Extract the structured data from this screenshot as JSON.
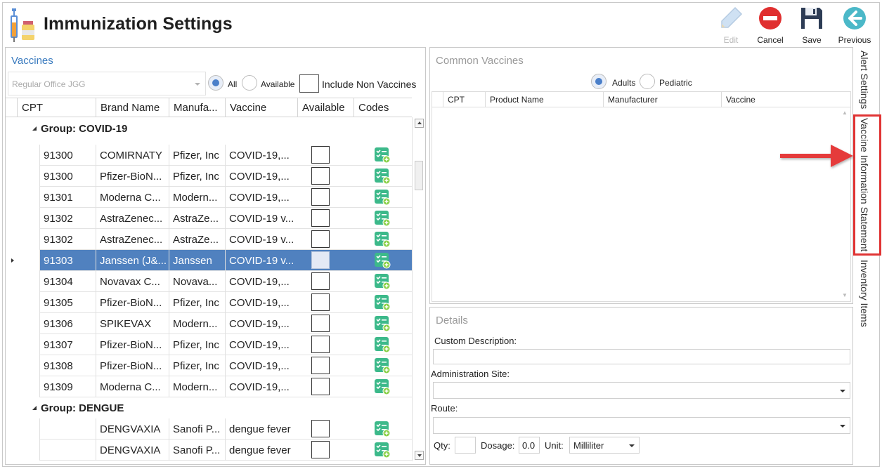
{
  "header": {
    "title": "Immunization Settings",
    "toolbar": [
      {
        "label": "Edit",
        "icon": "edit-pencil-icon",
        "enabled": false
      },
      {
        "label": "Cancel",
        "icon": "cancel-icon"
      },
      {
        "label": "Save",
        "icon": "save-floppy-icon"
      },
      {
        "label": "Previous",
        "icon": "previous-arrow-icon"
      }
    ]
  },
  "vaccines": {
    "label": "Vaccines",
    "office_placeholder": "Regular Office JGG",
    "filters": {
      "all": "All",
      "available": "Available",
      "include_non": "Include Non Vaccines",
      "selected": "All"
    },
    "columns": [
      "CPT",
      "Brand Name",
      "Manufa...",
      "Vaccine",
      "Available",
      "Codes"
    ],
    "groups": [
      {
        "title": "Group: COVID-19",
        "rows": [
          {
            "cpt": "91300",
            "brand": "COMIRNATY",
            "manufacturer": "Pfizer, Inc",
            "vaccine": "COVID-19,...",
            "selected": false
          },
          {
            "cpt": "91300",
            "brand": "Pfizer-BioN...",
            "manufacturer": "Pfizer, Inc",
            "vaccine": "COVID-19,...",
            "selected": false
          },
          {
            "cpt": "91301",
            "brand": "Moderna C...",
            "manufacturer": "Modern...",
            "vaccine": "COVID-19,...",
            "selected": false
          },
          {
            "cpt": "91302",
            "brand": "AstraZenec...",
            "manufacturer": "AstraZe...",
            "vaccine": "COVID-19 v...",
            "selected": false
          },
          {
            "cpt": "91302",
            "brand": "AstraZenec...",
            "manufacturer": "AstraZe...",
            "vaccine": "COVID-19 v...",
            "selected": false
          },
          {
            "cpt": "91303",
            "brand": "Janssen (J&...",
            "manufacturer": "Janssen",
            "vaccine": "COVID-19 v...",
            "selected": true
          },
          {
            "cpt": "91304",
            "brand": "Novavax C...",
            "manufacturer": "Novava...",
            "vaccine": "COVID-19,...",
            "selected": false
          },
          {
            "cpt": "91305",
            "brand": "Pfizer-BioN...",
            "manufacturer": "Pfizer, Inc",
            "vaccine": "COVID-19,...",
            "selected": false
          },
          {
            "cpt": "91306",
            "brand": "SPIKEVAX",
            "manufacturer": "Modern...",
            "vaccine": "COVID-19,...",
            "selected": false
          },
          {
            "cpt": "91307",
            "brand": "Pfizer-BioN...",
            "manufacturer": "Pfizer, Inc",
            "vaccine": "COVID-19,...",
            "selected": false
          },
          {
            "cpt": "91308",
            "brand": "Pfizer-BioN...",
            "manufacturer": "Pfizer, Inc",
            "vaccine": "COVID-19,...",
            "selected": false
          },
          {
            "cpt": "91309",
            "brand": "Moderna C...",
            "manufacturer": "Modern...",
            "vaccine": "COVID-19,...",
            "selected": false
          }
        ]
      },
      {
        "title": "Group: DENGUE",
        "rows": [
          {
            "cpt": "",
            "brand": "DENGVAXIA",
            "manufacturer": "Sanofi P...",
            "vaccine": "dengue fever",
            "selected": false
          },
          {
            "cpt": "",
            "brand": "DENGVAXIA",
            "manufacturer": "Sanofi P...",
            "vaccine": "dengue fever",
            "selected": false
          }
        ]
      }
    ]
  },
  "common_vaccines": {
    "title": "Common Vaccines",
    "options": {
      "adults": "Adults",
      "pediatric": "Pediatric",
      "selected": "Adults"
    },
    "columns": [
      "CPT",
      "Product Name",
      "Manufacturer",
      "Vaccine"
    ]
  },
  "details": {
    "title": "Details",
    "custom_description": "Custom Description:",
    "administration_site": "Administration Site:",
    "route": "Route:",
    "qty": "Qty:",
    "dosage": "Dosage:",
    "dosage_value": "0.0",
    "unit": "Unit:",
    "unit_value": "Milliliter"
  },
  "side_tabs": [
    "Alert Settings",
    "Vaccine Information Statement",
    "Inventory Items"
  ],
  "colors": {
    "accent": "#3a7bbf",
    "selection": "#5081bf",
    "highlight": "#e03434"
  }
}
